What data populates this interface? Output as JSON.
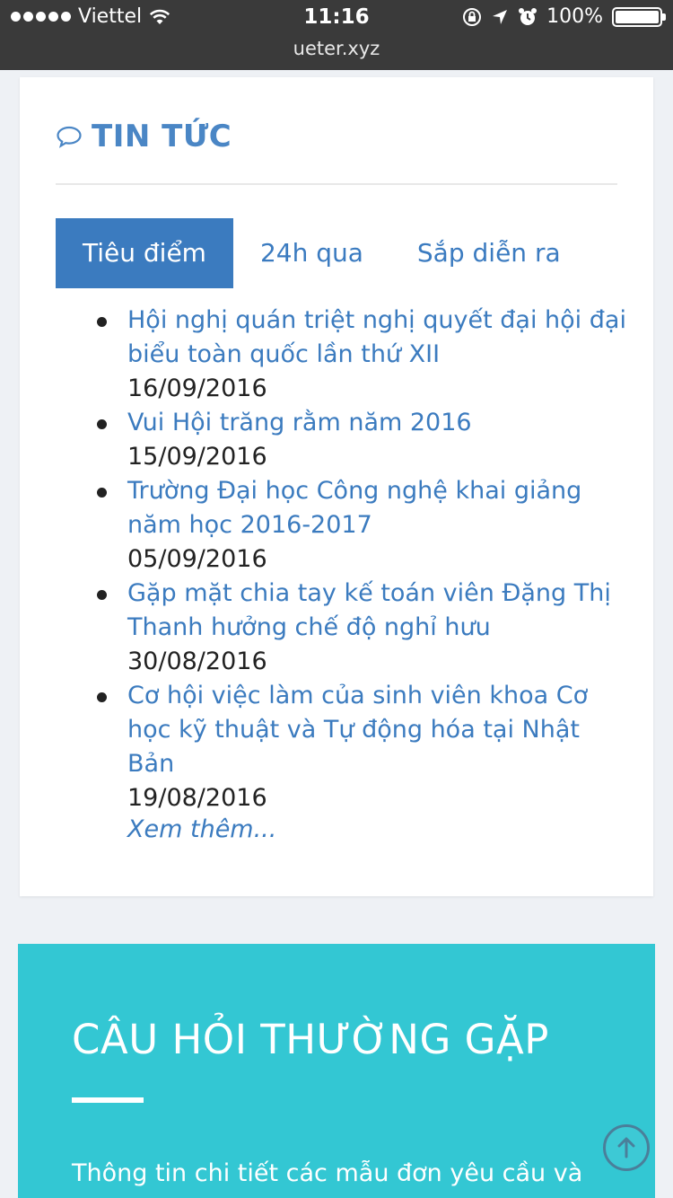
{
  "status_bar": {
    "carrier": "Viettel",
    "time": "11:16",
    "battery": "100%",
    "battery_level": 1.0,
    "url": "ueter.xyz"
  },
  "news": {
    "title": "TIN TỨC",
    "tabs": [
      {
        "label": "Tiêu điểm",
        "active": true
      },
      {
        "label": "24h qua",
        "active": false
      },
      {
        "label": "Sắp diễn ra",
        "active": false
      }
    ],
    "items": [
      {
        "title": "Hội nghị quán triệt nghị quyết đại hội đại biểu toàn quốc lần thứ XII",
        "date": "16/09/2016"
      },
      {
        "title": "Vui Hội trăng rằm năm 2016",
        "date": "15/09/2016"
      },
      {
        "title": "Trường Đại học Công nghệ khai giảng năm học 2016-2017",
        "date": "05/09/2016"
      },
      {
        "title": "Gặp mặt chia tay kế toán viên Đặng Thị Thanh hưởng chế độ nghỉ hưu",
        "date": "30/08/2016"
      },
      {
        "title": "Cơ hội việc làm của sinh viên khoa Cơ học kỹ thuật và Tự động hóa tại Nhật Bản",
        "date": "19/08/2016"
      }
    ],
    "more": "Xem thêm..."
  },
  "faq": {
    "title": "CÂU HỎI THƯỜNG GẶP",
    "description": "Thông tin chi tiết các mẫu đơn yêu cầu và"
  },
  "colors": {
    "accent": "#3b7bbf",
    "faq_bg": "#33c7d3",
    "status_bg": "#3a3a3a",
    "page_bg": "#eef1f5"
  },
  "icons": {
    "chat": "speech-bubble-icon",
    "scroll_top": "arrow-up-circle-icon"
  }
}
